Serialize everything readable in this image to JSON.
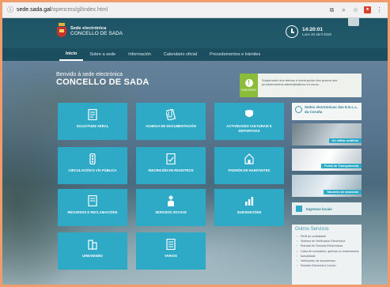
{
  "browser": {
    "domain": "sede.sada.gal",
    "path": "/opencms/gl/index.html"
  },
  "header": {
    "brand_line1": "Sede electrónica",
    "brand_line2": "CONCELLO DE SADA",
    "time": "14:20:01",
    "date": "Luns 20 abril 2020"
  },
  "nav": {
    "items": [
      {
        "label": "Inicio"
      },
      {
        "label": "Sobre a sede"
      },
      {
        "label": "Información"
      },
      {
        "label": "Calendario oficial"
      },
      {
        "label": "Procedementos e trámites"
      }
    ]
  },
  "hero": {
    "welcome": "Benvido á sede electrónica",
    "title": "CONCELLO DE SADA"
  },
  "notice": {
    "badge": "DISCORSO",
    "text": "Suspensión dos termos e interrupción dos prazos dos procedementos administrativos en curso"
  },
  "tiles": [
    {
      "label": "SOLICITUDE XERAL",
      "icon": "document-icon"
    },
    {
      "label": "ACHEGA DE DOCUMENTACIÓN",
      "icon": "paperclip-icon"
    },
    {
      "label": "ACTIVIDADES CULTURAIS E DEPORTIVAS",
      "icon": "masks-icon"
    },
    {
      "label": "CIRCULACIÓN E VÍA PÚBLICA",
      "icon": "traffic-light-icon"
    },
    {
      "label": "INSCRICIÓN EN REXISTROS",
      "icon": "form-icon"
    },
    {
      "label": "PADRÓN DE HABITANTES",
      "icon": "building-icon"
    },
    {
      "label": "RECURSOS E RECLAMACIÓNS",
      "icon": "document-icon"
    },
    {
      "label": "SERVIZOS SOCIAIS",
      "icon": "person-icon"
    },
    {
      "label": "SUBVENCIÓNS",
      "icon": "chart-icon"
    },
    {
      "label": "URBANISMO",
      "icon": "building-icon"
    },
    {
      "label": "VARIOS",
      "icon": "document-icon"
    }
  ],
  "sidebar": {
    "sedes_title": "Sedes electrónicas das E.E.L.L. da Coruña",
    "photos": [
      {
        "tag": "As miñas xestións"
      },
      {
        "tag": "Portal de Transparencia"
      },
      {
        "tag": "Taboleiro de anuncios"
      }
    ],
    "ingresos": "Ingresos locais",
    "otros_title": "Outros Servizos",
    "otros_items": [
      "Perfil do contratante",
      "Sistema de Verificación Electrónica",
      "Entrada de Facturas Electrónicas",
      "Caixa de suxestións, queixas ou reclamacións",
      "Actualidade",
      "Verificación de documentos",
      "Rexistro Electrónico Común"
    ]
  },
  "colors": {
    "tile": "#2ea9c6",
    "header": "#1e5566",
    "notice_badge": "#8cbd3a"
  }
}
